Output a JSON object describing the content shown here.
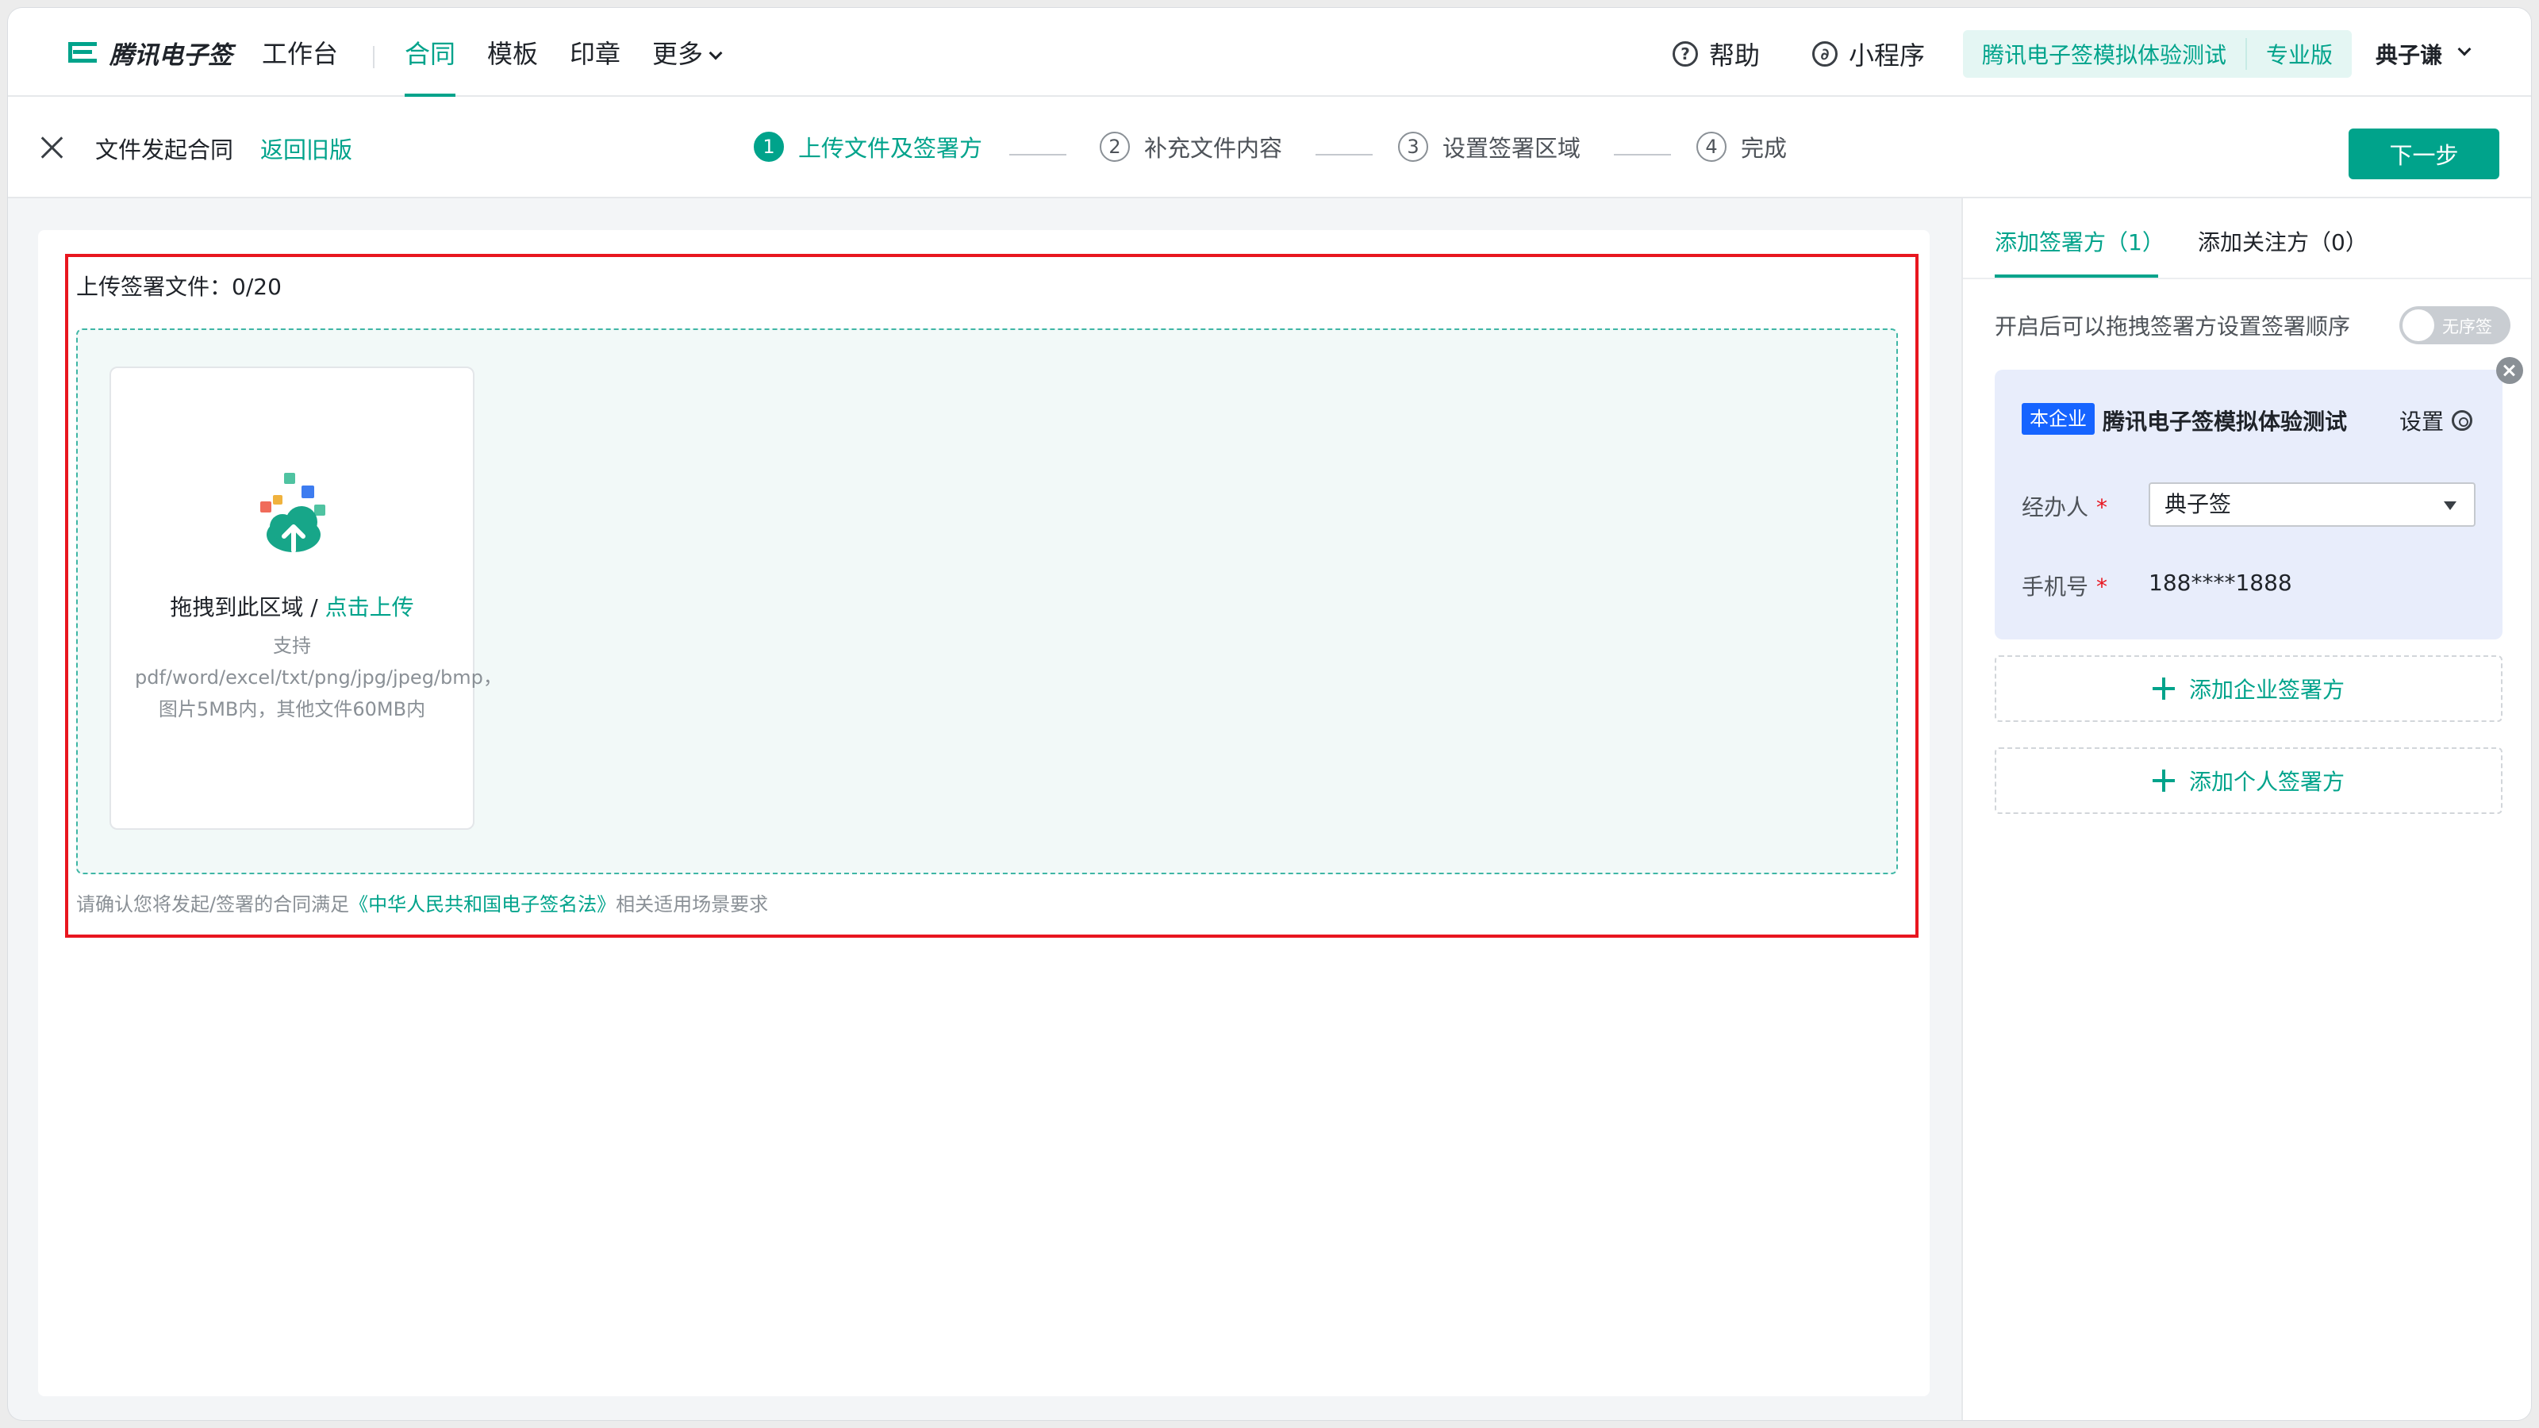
{
  "topnav": {
    "brand": "腾讯电子签",
    "items": [
      {
        "label": "工作台"
      },
      {
        "label": "合同",
        "active": true
      },
      {
        "label": "模板"
      },
      {
        "label": "印章"
      },
      {
        "label": "更多"
      }
    ],
    "help_label": "帮助",
    "miniprogram_label": "小程序",
    "org_name": "腾讯电子签模拟体验测试",
    "edition": "专业版",
    "user_name": "典子谦"
  },
  "subbar": {
    "title": "文件发起合同",
    "back_link": "返回旧版",
    "steps": [
      {
        "num": "1",
        "label": "上传文件及签署方",
        "active": true
      },
      {
        "num": "2",
        "label": "补充文件内容"
      },
      {
        "num": "3",
        "label": "设置签署区域"
      },
      {
        "num": "4",
        "label": "完成"
      }
    ],
    "next_label": "下一步"
  },
  "upload": {
    "label": "上传签署文件：0/20",
    "drop_text": "拖拽到此区域 / ",
    "click_text": "点击上传",
    "hint": "支持pdf/word/excel/txt/png/jpg/jpeg/bmp，图片5MB内，其他文件60MB内",
    "law_prefix": "请确认您将发起/签署的合同满足",
    "law_link": "《中华人民共和国电子签名法》",
    "law_suffix": "相关适用场景要求"
  },
  "right_panel": {
    "tabs": [
      {
        "label": "添加签署方（1）",
        "active": true
      },
      {
        "label": "添加关注方（0）"
      }
    ],
    "order_text": "开启后可以拖拽签署方设置签署顺序",
    "toggle_label": "无序签",
    "signer": {
      "tag": "本企业",
      "name": "腾讯电子签模拟体验测试",
      "settings_label": "设置",
      "operator_label": "经办人",
      "operator_value": "典子签",
      "phone_label": "手机号",
      "phone_value": "188****1888"
    },
    "add_enterprise_label": "添加企业签署方",
    "add_person_label": "添加个人签署方"
  },
  "colors": {
    "accent": "#00a38b",
    "highlight_border": "#e8161f",
    "enterprise_tag": "#1664ff"
  }
}
